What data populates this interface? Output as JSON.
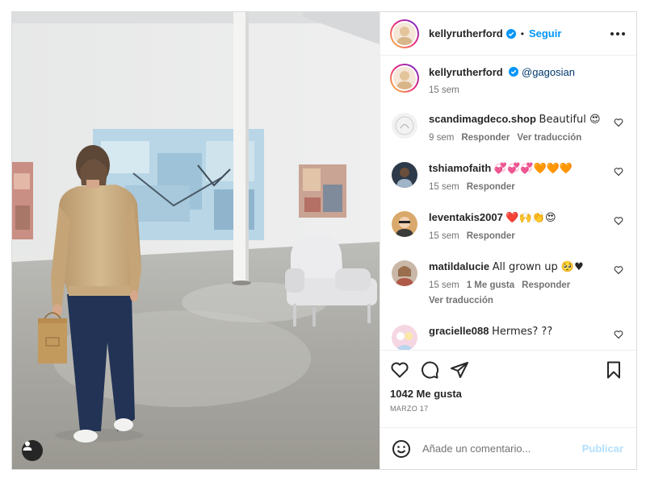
{
  "colors": {
    "accent": "#0095f6",
    "text": "#262626",
    "muted": "#737373",
    "border": "#dbdbdb",
    "publish_disabled": "#b2dffc"
  },
  "post": {
    "author": "kellyrutherford",
    "follow_label": "Seguir",
    "separator": "•",
    "more_icon": "more-horizontal-icon",
    "verified_icon": "verified-badge-icon"
  },
  "caption": {
    "user": "kellyrutherford",
    "mention": "@gagosian",
    "time": "15 sem"
  },
  "comments": [
    {
      "user": "scandimagdeco.shop",
      "text": "Beautiful 😍",
      "time": "9 sem",
      "likes": "",
      "reply": "Responder",
      "translate": "Ver traducción"
    },
    {
      "user": "tshiamofaith",
      "text": "💞💞💞🧡🧡🧡",
      "time": "15 sem",
      "likes": "",
      "reply": "Responder",
      "translate": ""
    },
    {
      "user": "leventakis2007",
      "text": "❤️🙌👏😍",
      "time": "15 sem",
      "likes": "",
      "reply": "Responder",
      "translate": ""
    },
    {
      "user": "matildalucie",
      "text": "All grown up 🥺♥",
      "time": "15 sem",
      "likes": "1 Me gusta",
      "reply": "Responder",
      "translate": "Ver traducción"
    },
    {
      "user": "gracielle088",
      "text": "Hermes? ??",
      "time": "",
      "likes": "",
      "reply": "",
      "translate": ""
    }
  ],
  "actions": {
    "like_icon": "heart-icon",
    "comment_icon": "comment-icon",
    "share_icon": "share-icon",
    "save_icon": "bookmark-icon",
    "likes_text": "1042 Me gusta",
    "date": "MARZO 17"
  },
  "add_comment": {
    "placeholder": "Añade un comentario...",
    "publish_label": "Publicar",
    "emoji_icon": "emoji-icon"
  },
  "photo": {
    "user_tag_icon": "user-tag-icon"
  }
}
